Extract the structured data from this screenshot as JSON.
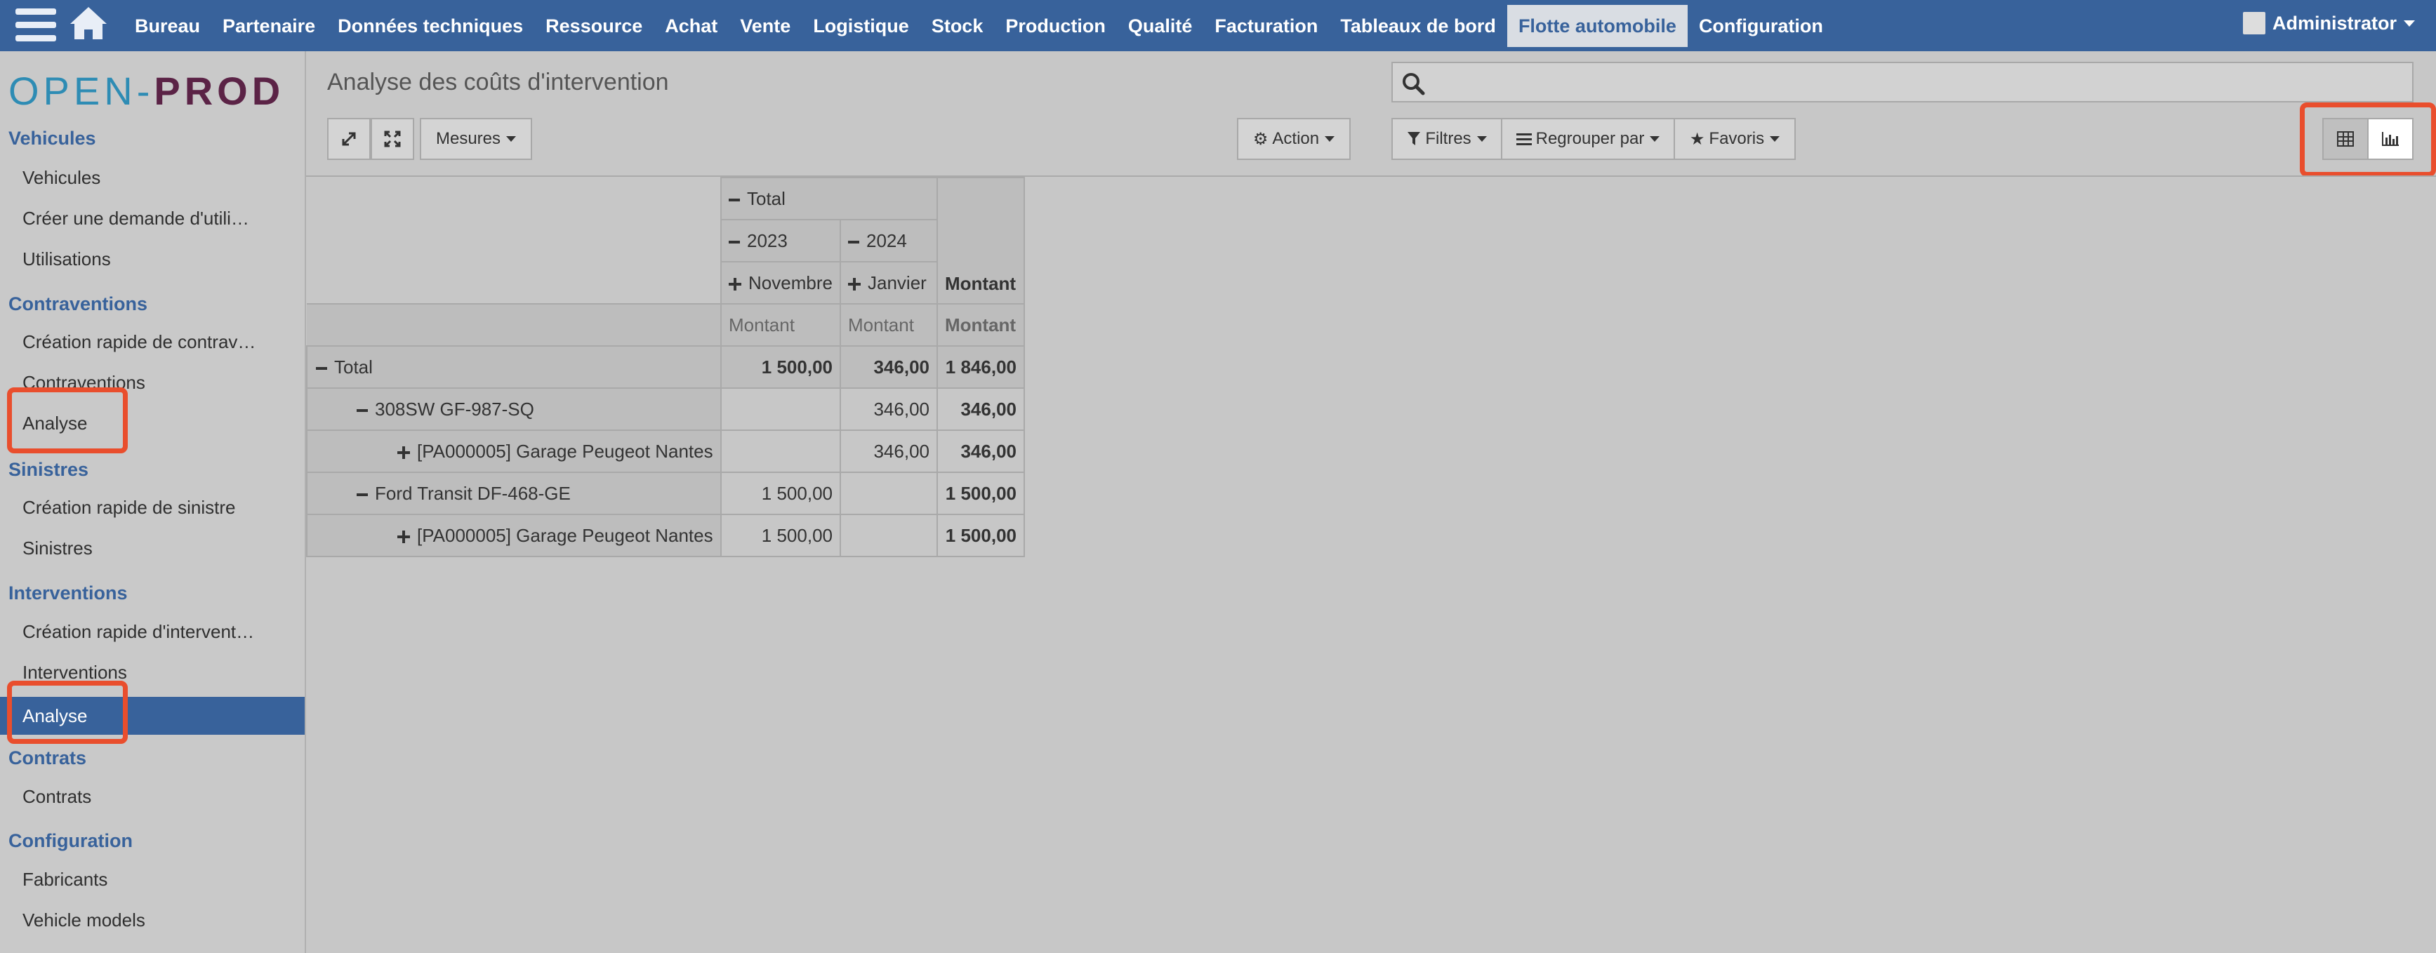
{
  "topbar": {
    "menu": [
      "Bureau",
      "Partenaire",
      "Données techniques",
      "Ressource",
      "Achat",
      "Vente",
      "Logistique",
      "Stock",
      "Production",
      "Qualité",
      "Facturation",
      "Tableaux de bord",
      "Flotte automobile",
      "Configuration"
    ],
    "active": "Flotte automobile",
    "user": "Administrator"
  },
  "logo": {
    "part1": "OPEN-",
    "part2": "PROD"
  },
  "sidebar": {
    "vehicules_head": "Vehicules",
    "vehicules_items": [
      "Vehicules",
      "Créer une demande d'utili…",
      "Utilisations"
    ],
    "contraventions_head": "Contraventions",
    "contraventions_items": [
      "Création rapide de contrav…",
      "Contraventions",
      "Analyse"
    ],
    "sinistres_head": "Sinistres",
    "sinistres_items": [
      "Création rapide de sinistre",
      "Sinistres"
    ],
    "interventions_head": "Interventions",
    "interventions_items": [
      "Création rapide d'intervent…",
      "Interventions",
      "Analyse"
    ],
    "contrats_head": "Contrats",
    "contrats_items": [
      "Contrats"
    ],
    "configuration_head": "Configuration",
    "configuration_items": [
      "Fabricants",
      "Vehicle models"
    ]
  },
  "page": {
    "title": "Analyse des coûts d'intervention",
    "measures": "Mesures",
    "action": "Action",
    "filters": "Filtres",
    "groupby": "Regrouper par",
    "favorites": "Favoris"
  },
  "pivot": {
    "col_total": "Total",
    "year1": "2023",
    "year2": "2024",
    "month1": "Novembre",
    "month2": "Janvier",
    "measure": "Montant",
    "rows": [
      {
        "label": "Total",
        "c1": "1 500,00",
        "c2": "346,00",
        "total": "1 846,00"
      },
      {
        "label": "308SW GF-987-SQ",
        "c1": "",
        "c2": "346,00",
        "total": "346,00"
      },
      {
        "label": "[PA000005] Garage Peugeot Nantes",
        "c1": "",
        "c2": "346,00",
        "total": "346,00"
      },
      {
        "label": "Ford Transit DF-468-GE",
        "c1": "1 500,00",
        "c2": "",
        "total": "1 500,00"
      },
      {
        "label": "[PA000005] Garage Peugeot Nantes",
        "c1": "1 500,00",
        "c2": "",
        "total": "1 500,00"
      }
    ]
  }
}
